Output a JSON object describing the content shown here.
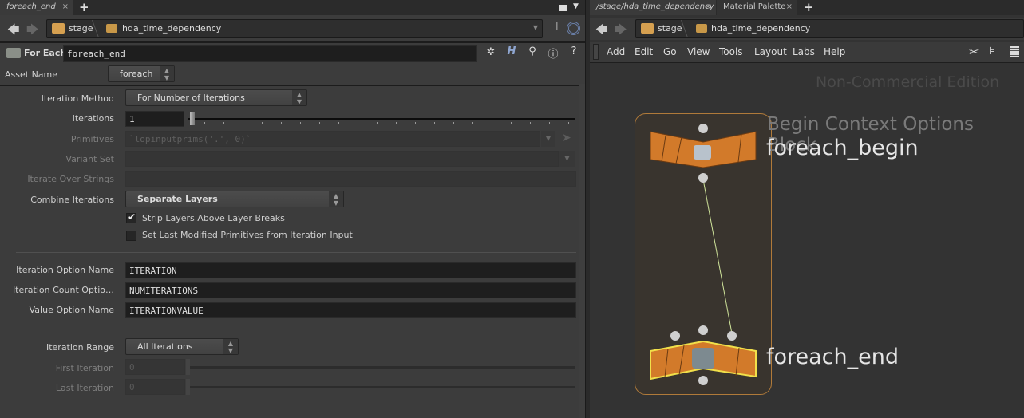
{
  "left_pane": {
    "tabs": [
      {
        "label": "foreach_end",
        "close": "×"
      }
    ],
    "add_tab": "+",
    "path": [
      {
        "label": "stage",
        "icon": "stage-icon"
      },
      {
        "label": "hda_time_dependency",
        "icon": "subnet-icon"
      }
    ],
    "node_type": "For Each",
    "node_name": "foreach_end",
    "asset_name_label": "Asset Name",
    "asset_name_value": "foreach",
    "params": {
      "iteration_method": {
        "label": "Iteration Method",
        "value": "For Number of Iterations"
      },
      "iterations": {
        "label": "Iterations",
        "value": "1"
      },
      "primitives": {
        "label": "Primitives",
        "value": "`lopinputprims('.', 0)`"
      },
      "variant_set": {
        "label": "Variant Set",
        "value": ""
      },
      "iterate_over_strings": {
        "label": "Iterate Over Strings",
        "value": ""
      },
      "combine_iterations": {
        "label": "Combine Iterations",
        "value": "Separate Layers"
      },
      "strip_layers": {
        "label": "Strip Layers Above Layer Breaks",
        "checked": true,
        "mark": "✔"
      },
      "set_last_modified": {
        "label": "Set Last Modified Primitives from Iteration Input",
        "checked": false
      },
      "iteration_option_name": {
        "label": "Iteration Option Name",
        "value": "ITERATION"
      },
      "iteration_count_option": {
        "label": "Iteration Count Optio…",
        "value": "NUMITERATIONS"
      },
      "value_option_name": {
        "label": "Value Option Name",
        "value": "ITERATIONVALUE"
      },
      "iteration_range": {
        "label": "Iteration Range",
        "value": "All Iterations"
      },
      "first_iteration": {
        "label": "First Iteration",
        "value": "0"
      },
      "last_iteration": {
        "label": "Last Iteration",
        "value": "0"
      }
    },
    "toolbar_icons": [
      "gear-icon",
      "help-h-icon",
      "search-icon",
      "info-icon",
      "question-icon"
    ]
  },
  "right_pane": {
    "tabs": [
      {
        "label": "/stage/hda_time_dependency",
        "close": "×"
      },
      {
        "label": "Material Palette",
        "close": "×"
      }
    ],
    "add_tab": "+",
    "path": [
      {
        "label": "stage"
      },
      {
        "label": "hda_time_dependency"
      }
    ],
    "menu": [
      "Add",
      "Edit",
      "Go",
      "View",
      "Tools",
      "Layout",
      "Labs",
      "Help"
    ],
    "watermark": "Non-Commercial Edition",
    "nodes": [
      {
        "name": "foreach_begin",
        "comment": "Begin Context Options Block",
        "color": "#d27a2a"
      },
      {
        "name": "foreach_end",
        "comment": "",
        "color": "#d27a2a",
        "selected": true
      }
    ]
  }
}
